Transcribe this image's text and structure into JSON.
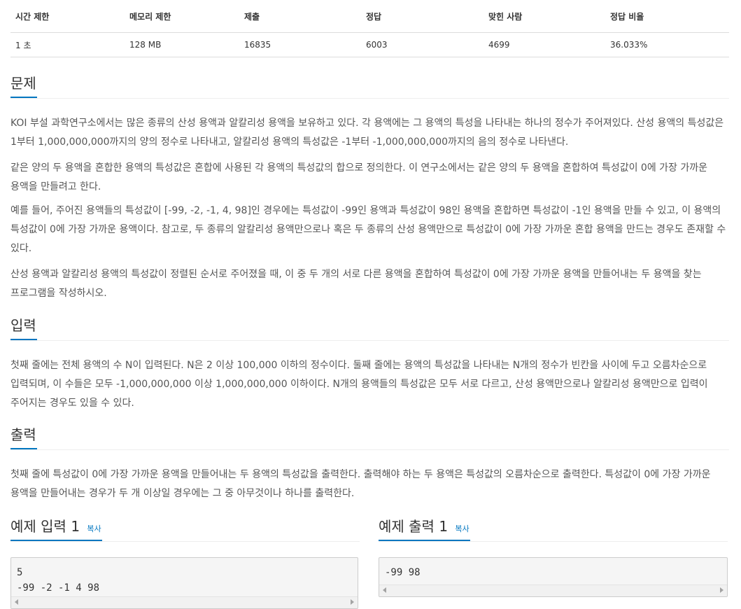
{
  "stats": {
    "headers": [
      "시간 제한",
      "메모리 제한",
      "제출",
      "정답",
      "맞힌 사람",
      "정답 비율"
    ],
    "values": [
      "1 초",
      "128 MB",
      "16835",
      "6003",
      "4699",
      "36.033%"
    ]
  },
  "problem": {
    "title": "문제",
    "paragraphs": [
      "KOI 부설 과학연구소에서는 많은 종류의 산성 용액과 알칼리성 용액을 보유하고 있다. 각 용액에는 그 용액의 특성을 나타내는 하나의 정수가 주어져있다. 산성 용액의 특성값은 1부터 1,000,000,000까지의 양의 정수로 나타내고, 알칼리성 용액의 특성값은 -1부터 -1,000,000,000까지의 음의 정수로 나타낸다.",
      "같은 양의 두 용액을 혼합한 용액의 특성값은 혼합에 사용된 각 용액의 특성값의 합으로 정의한다. 이 연구소에서는 같은 양의 두 용액을 혼합하여 특성값이 0에 가장 가까운 용액을 만들려고 한다.",
      "예를 들어, 주어진 용액들의 특성값이 [-99, -2, -1, 4, 98]인 경우에는 특성값이 -99인 용액과 특성값이 98인 용액을 혼합하면 특성값이 -1인 용액을 만들 수 있고, 이 용액의 특성값이 0에 가장 가까운 용액이다. 참고로, 두 종류의 알칼리성 용액만으로나 혹은 두 종류의 산성 용액만으로 특성값이 0에 가장 가까운 혼합 용액을 만드는 경우도 존재할 수 있다.",
      "산성 용액과 알칼리성 용액의 특성값이 정렬된 순서로 주어졌을 때, 이 중 두 개의 서로 다른 용액을 혼합하여 특성값이 0에 가장 가까운 용액을 만들어내는 두 용액을 찾는 프로그램을 작성하시오."
    ]
  },
  "input": {
    "title": "입력",
    "text": "첫째 줄에는 전체 용액의 수 N이 입력된다. N은 2 이상 100,000 이하의 정수이다. 둘째 줄에는 용액의 특성값을 나타내는 N개의 정수가 빈칸을 사이에 두고 오름차순으로 입력되며, 이 수들은 모두 -1,000,000,000 이상 1,000,000,000 이하이다. N개의 용액들의 특성값은 모두 서로 다르고, 산성 용액만으로나 알칼리성 용액만으로 입력이 주어지는 경우도 있을 수 있다."
  },
  "output": {
    "title": "출력",
    "text": "첫째 줄에 특성값이 0에 가장 가까운 용액을 만들어내는 두 용액의 특성값을 출력한다. 출력해야 하는 두 용액은 특성값의 오름차순으로 출력한다. 특성값이 0에 가장 가까운 용액을 만들어내는 경우가 두 개 이상일 경우에는 그 중 아무것이나 하나를 출력한다."
  },
  "sample_input": {
    "title": "예제 입력 1",
    "copy_label": "복사",
    "content": "5\n-99 -2 -1 4 98"
  },
  "sample_output": {
    "title": "예제 출력 1",
    "copy_label": "복사",
    "content": "-99 98"
  }
}
